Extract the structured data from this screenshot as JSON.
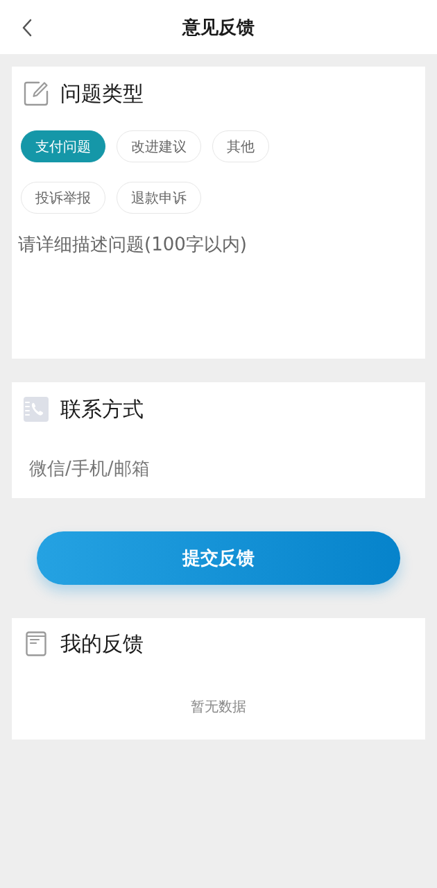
{
  "header": {
    "title": "意见反馈"
  },
  "issue_type": {
    "title": "问题类型",
    "options": [
      {
        "label": "支付问题",
        "selected": true
      },
      {
        "label": "改进建议",
        "selected": false
      },
      {
        "label": "其他",
        "selected": false
      },
      {
        "label": "投诉举报",
        "selected": false
      },
      {
        "label": "退款申诉",
        "selected": false
      }
    ]
  },
  "description": {
    "placeholder": "请详细描述问题(100字以内)"
  },
  "contact": {
    "title": "联系方式",
    "placeholder": "微信/手机/邮箱"
  },
  "submit_button": {
    "label": "提交反馈"
  },
  "my_feedback": {
    "title": "我的反馈",
    "empty_text": "暂无数据"
  }
}
